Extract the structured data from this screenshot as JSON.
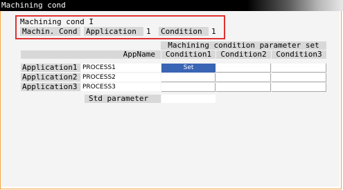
{
  "window": {
    "title": "Machining cond"
  },
  "header": {
    "subtitle": "Machining cond I",
    "machin_cond_label": "Machin. Cond",
    "application_label": "Application",
    "application_value": "1",
    "condition_label": "Condition",
    "condition_value": "1"
  },
  "table": {
    "group_header": "Machining condition parameter set",
    "appname_header": "AppName",
    "columns": [
      "Condition1",
      "Condition2",
      "Condition3"
    ],
    "rows": [
      {
        "label": "Application1",
        "name": "PROCESS1",
        "cells": [
          "Set",
          "",
          ""
        ]
      },
      {
        "label": "Application2",
        "name": "PROCESS2",
        "cells": [
          "",
          "",
          ""
        ]
      },
      {
        "label": "Application3",
        "name": "PROCESS3",
        "cells": [
          "",
          "",
          ""
        ]
      }
    ],
    "std_parameter_label": "Std parameter",
    "std_parameter_value": ""
  },
  "colors": {
    "selected_cell": "#3a64b4",
    "highlight_box": "#e03030",
    "window_border": "#f0a23c"
  }
}
